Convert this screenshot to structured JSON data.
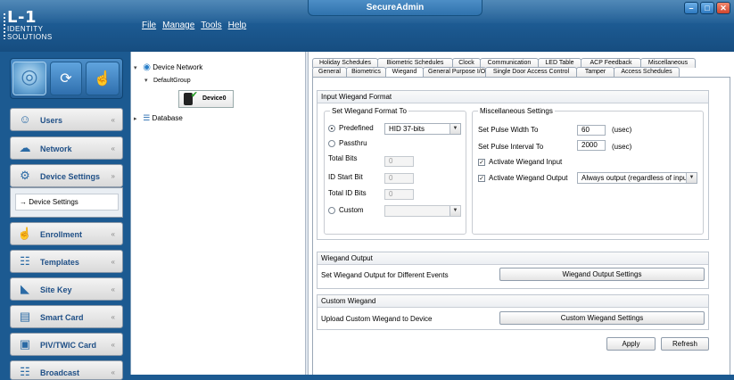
{
  "app": {
    "title": "SecureAdmin",
    "logo_line1": "L-1",
    "logo_line2": "IDENTITY",
    "logo_line3": "SOLUTIONS",
    "menu": [
      "File",
      "Manage",
      "Tools",
      "Help"
    ],
    "window_buttons": [
      "–",
      "□",
      "✕"
    ]
  },
  "sidebar": {
    "modes": [
      "fingerprint-mode-icon",
      "sync-mode-icon",
      "hand-mode-icon"
    ],
    "items": [
      {
        "label": "Users",
        "icon": "users-icon",
        "chevron": "«"
      },
      {
        "label": "Network",
        "icon": "network-icon",
        "chevron": "«"
      },
      {
        "label": "Device Settings",
        "icon": "device-settings-icon",
        "chevron": "»"
      },
      {
        "label": "Enrollment",
        "icon": "enrollment-icon",
        "chevron": "«"
      },
      {
        "label": "Templates",
        "icon": "templates-icon",
        "chevron": "«"
      },
      {
        "label": "Site Key",
        "icon": "site-key-icon",
        "chevron": "«"
      },
      {
        "label": "Smart Card",
        "icon": "smart-card-icon",
        "chevron": "«"
      },
      {
        "label": "PIV/TWIC Card",
        "icon": "piv-card-icon",
        "chevron": "«"
      },
      {
        "label": "Broadcast",
        "icon": "broadcast-icon",
        "chevron": "«"
      }
    ],
    "sub_item": "→ Device Settings"
  },
  "tree": {
    "root": "Device Network",
    "group": "DefaultGroup",
    "device": "Device0",
    "database": "Database"
  },
  "tabs": {
    "row1": [
      "Holiday Schedules",
      "Biometric Schedules",
      "Clock",
      "Communication",
      "LED Table",
      "ACP Feedback",
      "Miscellaneous"
    ],
    "row2": [
      "General",
      "Biometrics",
      "Wiegand",
      "General Purpose I/O",
      "Single Door Access Control",
      "Tamper",
      "Access Schedules"
    ],
    "active": "Wiegand"
  },
  "input_wiegand": {
    "title": "Input Wiegand Format",
    "set_format_legend": "Set Wiegand Format To",
    "predefined_label": "Predefined",
    "predefined_value": "HID 37-bits",
    "passthru_label": "Passthru",
    "total_bits_label": "Total Bits",
    "total_bits_value": "0",
    "id_start_label": "ID Start Bit",
    "id_start_value": "0",
    "total_id_label": "Total ID Bits",
    "total_id_value": "0",
    "custom_label": "Custom",
    "custom_value": ""
  },
  "misc": {
    "legend": "Miscellaneous Settings",
    "pulse_width_label": "Set Pulse Width To",
    "pulse_width_value": "60",
    "pulse_width_unit": "(usec)",
    "pulse_interval_label": "Set Pulse Interval To",
    "pulse_interval_value": "2000",
    "pulse_interval_unit": "(usec)",
    "activate_input_label": "Activate Wiegand Input",
    "activate_input_checked": true,
    "activate_output_label": "Activate Wiegand Output",
    "activate_output_checked": true,
    "output_mode_value": "Always output (regardless of input sou"
  },
  "wiegand_output": {
    "title": "Wiegand Output",
    "desc": "Set Wiegand Output for Different Events",
    "button": "Wiegand Output Settings"
  },
  "custom_wiegand": {
    "title": "Custom Wiegand",
    "desc": "Upload Custom Wiegand to Device",
    "button": "Custom Wiegand Settings"
  },
  "actions": {
    "apply": "Apply",
    "refresh": "Refresh"
  }
}
